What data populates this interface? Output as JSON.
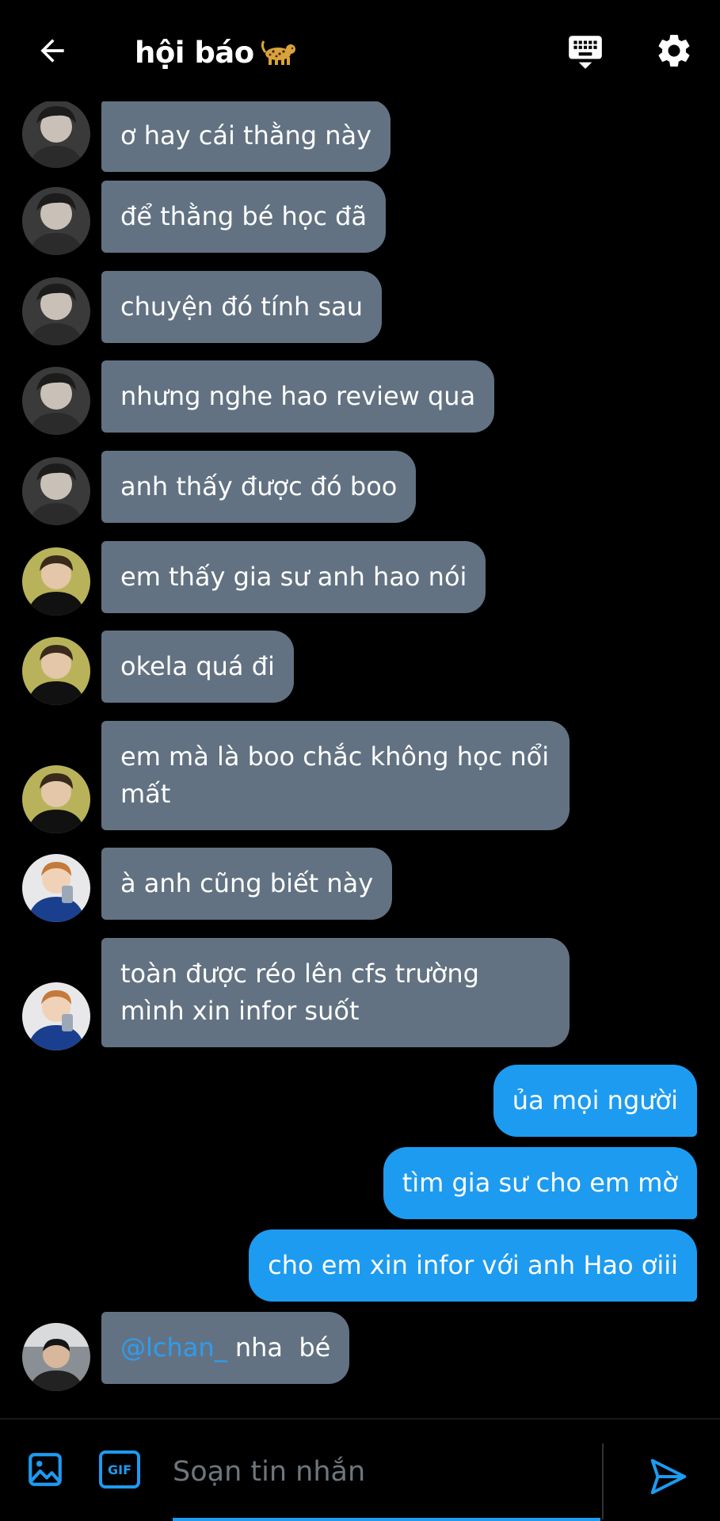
{
  "header": {
    "title": "hội báo",
    "title_emoji": "leopard-emoji",
    "back_icon": "arrow-left-icon",
    "keyboard_icon": "keyboard-icon",
    "settings_icon": "gear-icon"
  },
  "colors": {
    "background": "#000000",
    "incoming_bubble": "#627282",
    "outgoing_bubble": "#1d9bf0",
    "mention": "#2f9cf0",
    "accent": "#1d9bf0"
  },
  "messages": [
    {
      "sender": "member-1",
      "text": "ơ hay cái thằng này",
      "direction": "in"
    },
    {
      "sender": "member-1",
      "text": "để thằng bé học đã",
      "direction": "in"
    },
    {
      "sender": "member-1",
      "text": "chuyện đó tính sau",
      "direction": "in"
    },
    {
      "sender": "member-1",
      "text": "nhưng nghe hao review qua",
      "direction": "in"
    },
    {
      "sender": "member-1",
      "text": "anh thấy được đó boo",
      "direction": "in"
    },
    {
      "sender": "member-2",
      "text": "em thấy gia sư anh hao nói",
      "direction": "in"
    },
    {
      "sender": "member-2",
      "text": "okela quá đi",
      "direction": "in"
    },
    {
      "sender": "member-2",
      "text": "em mà là boo chắc không học nổi mất",
      "direction": "in"
    },
    {
      "sender": "member-3",
      "text": "à anh cũng biết này",
      "direction": "in"
    },
    {
      "sender": "member-3",
      "text": "toàn được réo lên cfs trường mình xin infor suốt",
      "direction": "in"
    },
    {
      "sender": "me",
      "text": "ủa mọi người",
      "direction": "out"
    },
    {
      "sender": "me",
      "text": "tìm gia sư cho em mờ",
      "direction": "out"
    },
    {
      "sender": "me",
      "text": "cho em xin infor với anh Hao ơiii",
      "direction": "out"
    },
    {
      "sender": "member-4",
      "mention": "@lchan_",
      "text": " nha  bé",
      "direction": "in"
    }
  ],
  "composer": {
    "placeholder": "Soạn tin nhắn",
    "value": "",
    "media_icon": "image-icon",
    "gif_label": "GIF",
    "send_icon": "send-icon"
  }
}
